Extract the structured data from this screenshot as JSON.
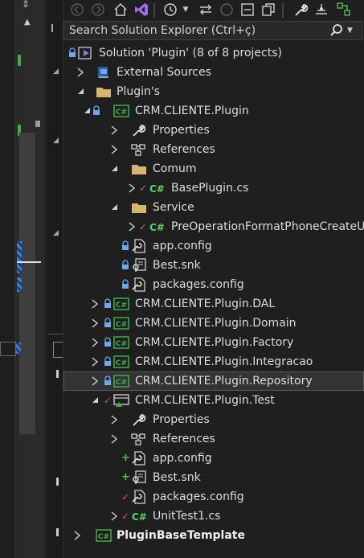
{
  "search": {
    "placeholder": "Search Solution Explorer (Ctrl+ç)"
  },
  "tree": {
    "solution": "Solution 'Plugin' (8 of 8 projects)",
    "external_sources": "External Sources",
    "plugins_folder": "Plugin's",
    "crm_plugin": {
      "name": "CRM.CLIENTE.Plugin",
      "properties": "Properties",
      "references": "References",
      "comum": "Comum",
      "baseplugin": "BasePlugin.cs",
      "service": "Service",
      "preoperation": "PreOperationFormatPhoneCreateUp",
      "app_config": "app.config",
      "best_snk": "Best.snk",
      "packages_config": "packages.config"
    },
    "dal": "CRM.CLIENTE.Plugin.DAL",
    "domain": "CRM.CLIENTE.Plugin.Domain",
    "factory": "CRM.CLIENTE.Plugin.Factory",
    "integracao": "CRM.CLIENTE.Plugin.Integracao",
    "repository": "CRM.CLIENTE.Plugin.Repository",
    "test": {
      "name": "CRM.CLIENTE.Plugin.Test",
      "properties": "Properties",
      "references": "References",
      "app_config": "app.config",
      "best_snk": "Best.snk",
      "packages_config": "packages.config",
      "unittest": "UnitTest1.cs"
    },
    "template": "PluginBaseTemplate"
  },
  "colors": {
    "background": "#1f1f1f",
    "selection": "#333336",
    "project_green": "#3fae49",
    "csharp_green": "#5fd068",
    "lock_blue": "#6fa7e8",
    "folder_tan": "#d8b472",
    "error_red": "#e05252",
    "add_green": "#5fb65f"
  }
}
